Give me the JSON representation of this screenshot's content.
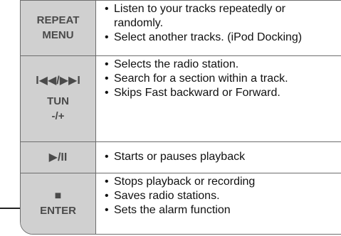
{
  "rows": [
    {
      "key_lines": [
        "REPEAT",
        "MENU"
      ],
      "desc": [
        {
          "bullet": "•",
          "text": "Listen to your tracks repeatedly or"
        },
        {
          "bullet": "",
          "text": "randomly."
        },
        {
          "bullet": "•",
          "text": "Select another tracks. (iPod Docking)"
        }
      ]
    },
    {
      "key_lines": [
        "I◀◀/▶▶I",
        "TUN",
        "-/+"
      ],
      "desc": [
        {
          "bullet": "•",
          "text": "Selects the radio station."
        },
        {
          "bullet": "•",
          "text": "Search for a section within a track."
        },
        {
          "bullet": "•",
          "text": "Skips Fast backward or Forward."
        }
      ]
    },
    {
      "key_lines": [
        "▶/II"
      ],
      "desc": [
        {
          "bullet": "•",
          "text": "Starts or pauses playback"
        }
      ]
    },
    {
      "key_lines": [
        "■",
        "ENTER"
      ],
      "desc": [
        {
          "bullet": "•",
          "text": "Stops playback or recording"
        },
        {
          "bullet": "•",
          "text": "Saves radio stations."
        },
        {
          "bullet": "•",
          "text": "Sets the alarm function"
        }
      ]
    }
  ]
}
